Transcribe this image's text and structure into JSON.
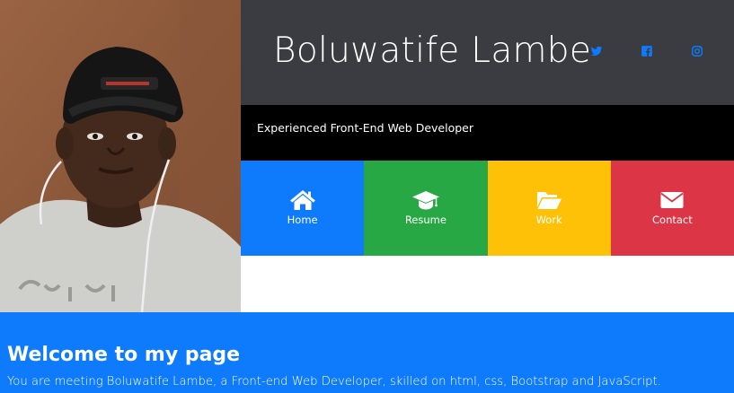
{
  "header": {
    "name": "Boluwatife Lambe",
    "social": [
      {
        "icon": "twitter-icon",
        "color": "#0d7bfb"
      },
      {
        "icon": "facebook-icon",
        "color": "#0d7bfb"
      },
      {
        "icon": "instagram-icon",
        "color": "#0d7bfb"
      }
    ]
  },
  "tagline": "Experienced Front-End Web Developer",
  "nav": {
    "tiles": [
      {
        "label": "Home",
        "icon": "home-icon",
        "color": "#0d7bfb"
      },
      {
        "label": "Resume",
        "icon": "graduation-cap-icon",
        "color": "#28a745"
      },
      {
        "label": "Work",
        "icon": "folder-open-icon",
        "color": "#ffc107"
      },
      {
        "label": "Contact",
        "icon": "envelope-icon",
        "color": "#dc3545"
      }
    ]
  },
  "welcome": {
    "heading": "Welcome to my page",
    "text": "You are meeting Boluwatife Lambe, a Front-end Web Developer, skilled on html, css, Bootstrap and JavaScript."
  }
}
